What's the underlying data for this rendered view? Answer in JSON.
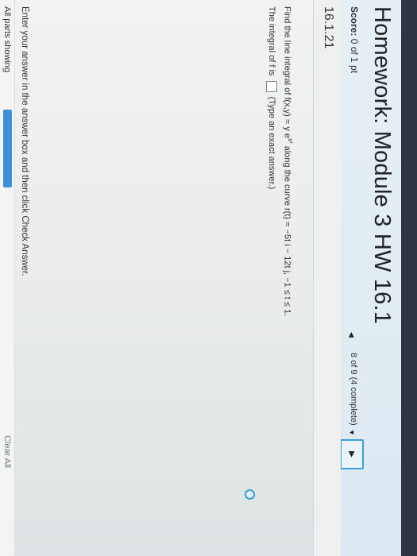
{
  "header": {
    "title": "Homework: Module 3 HW 16.1",
    "score_label": "Score:",
    "score_value": "0 of 1 pt"
  },
  "question": {
    "id": "16.1.21",
    "prompt_start": "Find the line integral of f(x,y) = y e",
    "prompt_exponent": "x²",
    "prompt_end": " along the curve r(t) = −5t i − 12t j, −1 ≤ t ≤ 1.",
    "answer_prefix": "The integral of f is",
    "answer_suffix": "(Type an exact answer.)",
    "answer_value": ""
  },
  "navigation": {
    "progress": "8 of 9 (4 complete)",
    "prev_icon": "triangle-left-icon",
    "next_icon": "triangle-down-icon"
  },
  "footer": {
    "instruction": "Enter your answer in the answer box and then click Check Answer.",
    "parts_label": "All parts showing",
    "clear_all_label": "Clear All"
  },
  "colors": {
    "accent": "#3aa0d8",
    "progress_bar": "#3d8fd6",
    "header_bg": "#e6eff5"
  }
}
